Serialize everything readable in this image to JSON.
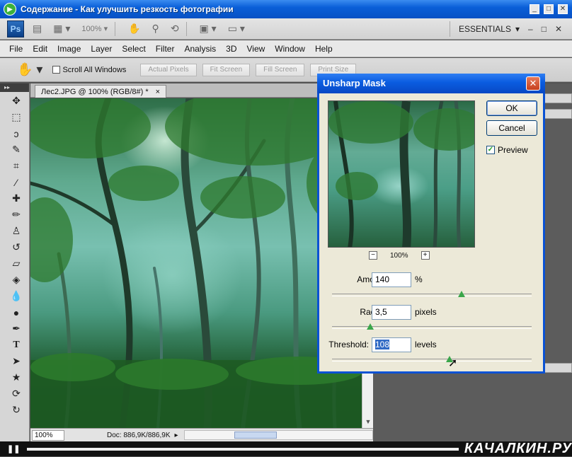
{
  "window": {
    "title": "Содержание - Как улучшить резкость фотографии",
    "minimize": "_",
    "maximize": "□",
    "close": "✕"
  },
  "appbar": {
    "logo": "Ps",
    "zoom": "100%",
    "workspace": "ESSENTIALS",
    "win_min": "–",
    "win_max": "□",
    "win_close": "✕"
  },
  "menu": [
    "File",
    "Edit",
    "Image",
    "Layer",
    "Select",
    "Filter",
    "Analysis",
    "3D",
    "View",
    "Window",
    "Help"
  ],
  "options": {
    "scroll_all_label": "Scroll All Windows",
    "buttons": [
      "Actual Pixels",
      "Fit Screen",
      "Fill Screen",
      "Print Size"
    ]
  },
  "document": {
    "tab_title": "Лес2.JPG @ 100% (RGB/8#) *",
    "tab_close": "×",
    "zoom": "100%",
    "doc_info": "Doc: 886,9K/886,9K"
  },
  "dialog": {
    "title": "Unsharp Mask",
    "close": "✕",
    "ok": "OK",
    "cancel": "Cancel",
    "preview_label": "Preview",
    "preview_checked": "✓",
    "preview_zoom": "100%",
    "zoom_out": "−",
    "zoom_in": "+",
    "amount": {
      "label": "Amount:",
      "value": "140",
      "unit": "%",
      "slider_fraction": 0.65
    },
    "radius": {
      "label": "Radius:",
      "value": "3,5",
      "unit": "pixels",
      "slider_fraction": 0.19
    },
    "threshold": {
      "label": "Threshold:",
      "value": "108",
      "unit": "levels",
      "slider_fraction": 0.59
    }
  },
  "videobar": {
    "play": "❚❚",
    "watermark": "КАЧАЛКИН.РУ"
  }
}
